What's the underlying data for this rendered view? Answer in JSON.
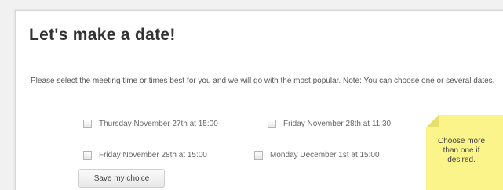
{
  "page": {
    "title": "Let's make a date!",
    "intro": "Please select the meeting time or times best for you and we will go with the most popular. Note: You can choose one or several dates."
  },
  "options": [
    {
      "label": "Thursday November 27th at 15:00",
      "checked": false
    },
    {
      "label": "Friday November 28th at 11:30",
      "checked": false
    },
    {
      "label": "Friday November 28th at 15:00",
      "checked": false
    },
    {
      "label": "Monday December 1st at 15:00",
      "checked": false
    }
  ],
  "actions": {
    "save_label": "Save my choice"
  },
  "sticky_note": {
    "text": "Choose more than one if desired.",
    "color": "#fbf48a"
  },
  "colors": {
    "title": "#333333",
    "body_text": "#555555",
    "background": "#f1f1f1",
    "panel": "#ffffff"
  }
}
